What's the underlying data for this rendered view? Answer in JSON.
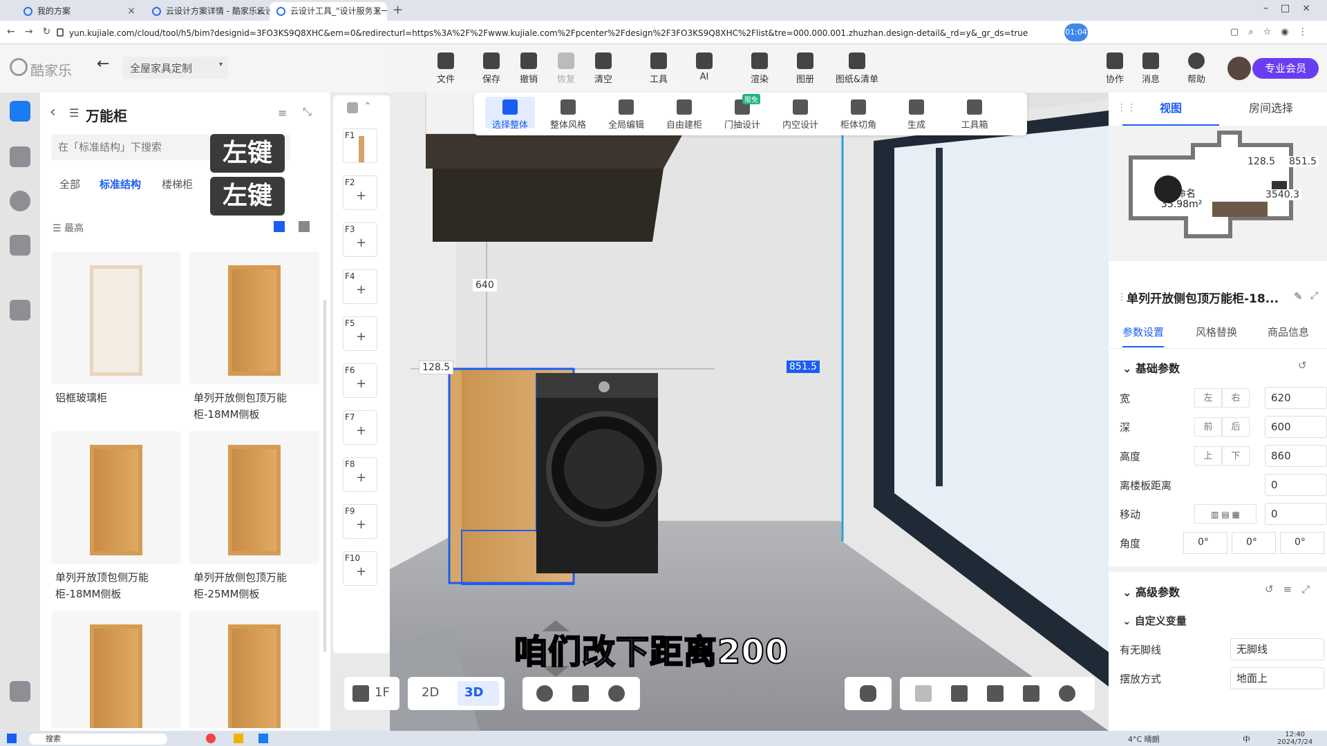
{
  "browser": {
    "tabs": [
      {
        "label": "我的方案",
        "active": false
      },
      {
        "label": "云设计方案详情 - 酷家乐云设计",
        "active": false
      },
      {
        "label": "云设计工具_\"设计服务王一 \"",
        "active": true
      }
    ],
    "url": "yun.kujiale.com/cloud/tool/h5/bim?designid=3FO3KS9Q8XHC&em=0&redirecturl=https%3A%2F%2Fwww.kujiale.com%2Fpcenter%2Fdesign%2F3FO3KS9Q8XHC%2Flist&tre=000.000.001.zhuzhan.design-detail&_rd=y&_gr_ds=true",
    "recording_badge": "01:04"
  },
  "app": {
    "logo": "酷家乐",
    "mode_select": "全屋家具定制",
    "toolbar": [
      "文件",
      "保存",
      "撤销",
      "恢复",
      "清空",
      "工具",
      "AI",
      "渲染",
      "图册",
      "图纸&清单"
    ],
    "right_tools": [
      "协作",
      "消息",
      "帮助"
    ],
    "vip_label": "专业会员",
    "subtools": [
      "选择整体",
      "整体风格",
      "全局编辑",
      "自由建柜",
      "门抽设计",
      "内空设计",
      "柜体切角",
      "生成",
      "工具箱"
    ],
    "subtool_badge": "限免"
  },
  "library": {
    "title": "万能柜",
    "search_placeholder": "在「标准结构」下搜索",
    "overlay_labels": [
      "左键",
      "左键"
    ],
    "categories": [
      "全部",
      "标准结构",
      "楼梯柜"
    ],
    "active_category": "标准结构",
    "sort_label": "最高",
    "items": [
      {
        "name": "铝框玻璃柜"
      },
      {
        "name": "单列开放侧包顶万能柜-18MM侧板"
      },
      {
        "name": "单列开放顶包侧万能柜-18MM侧板"
      },
      {
        "name": "单列开放侧包顶万能柜-25MM侧板"
      },
      {
        "name": ""
      },
      {
        "name": ""
      }
    ]
  },
  "floors": [
    "F1",
    "F2",
    "F3",
    "F4",
    "F5",
    "F6",
    "F7",
    "F8",
    "F9",
    "F10"
  ],
  "scene": {
    "dim_top": "640",
    "dim_left": "128.5",
    "dim_right": "851.5",
    "subtitle": "咱们改下距离200"
  },
  "bottom_bar": {
    "floor": "1F",
    "view_2d": "2D",
    "view_3d": "3D"
  },
  "right_panel": {
    "tabs": [
      "视图",
      "房间选择"
    ],
    "active_tab": "视图",
    "minimap": {
      "room_name": "未命名",
      "area": "35.98m²",
      "dim_a": "128.5",
      "dim_b": "851.5",
      "dim_c": "3540.3"
    },
    "object_title": "单列开放侧包顶万能柜-18...",
    "obj_tabs": [
      "参数设置",
      "风格替换",
      "商品信息"
    ],
    "active_obj_tab": "参数设置",
    "basic_section": "基础参数",
    "params": [
      {
        "label": "宽",
        "seg1": "左",
        "seg2": "右",
        "value": "620"
      },
      {
        "label": "深",
        "seg1": "前",
        "seg2": "后",
        "value": "600"
      },
      {
        "label": "高度",
        "seg1": "上",
        "seg2": "下",
        "value": "860"
      },
      {
        "label": "离楼板距离",
        "seg1": "",
        "seg2": "",
        "value": "0"
      },
      {
        "label": "移动",
        "seg1": "",
        "seg2": "",
        "value": "0"
      }
    ],
    "angle_label": "角度",
    "angles": [
      "0°",
      "0°",
      "0°"
    ],
    "advanced_section": "高级参数",
    "custom_section": "自定义变量",
    "custom_params": [
      {
        "label": "有无脚线",
        "value": "无脚线"
      },
      {
        "label": "摆放方式",
        "value": "地面上"
      }
    ]
  },
  "taskbar": {
    "search": "搜索",
    "weather": "4°C 晴朗",
    "ime": "中",
    "time": "12:40",
    "date": "2024/7/24"
  },
  "colors": {
    "accent": "#1a5df2",
    "vip": "#6b3df0",
    "selection": "#1a5df2"
  }
}
